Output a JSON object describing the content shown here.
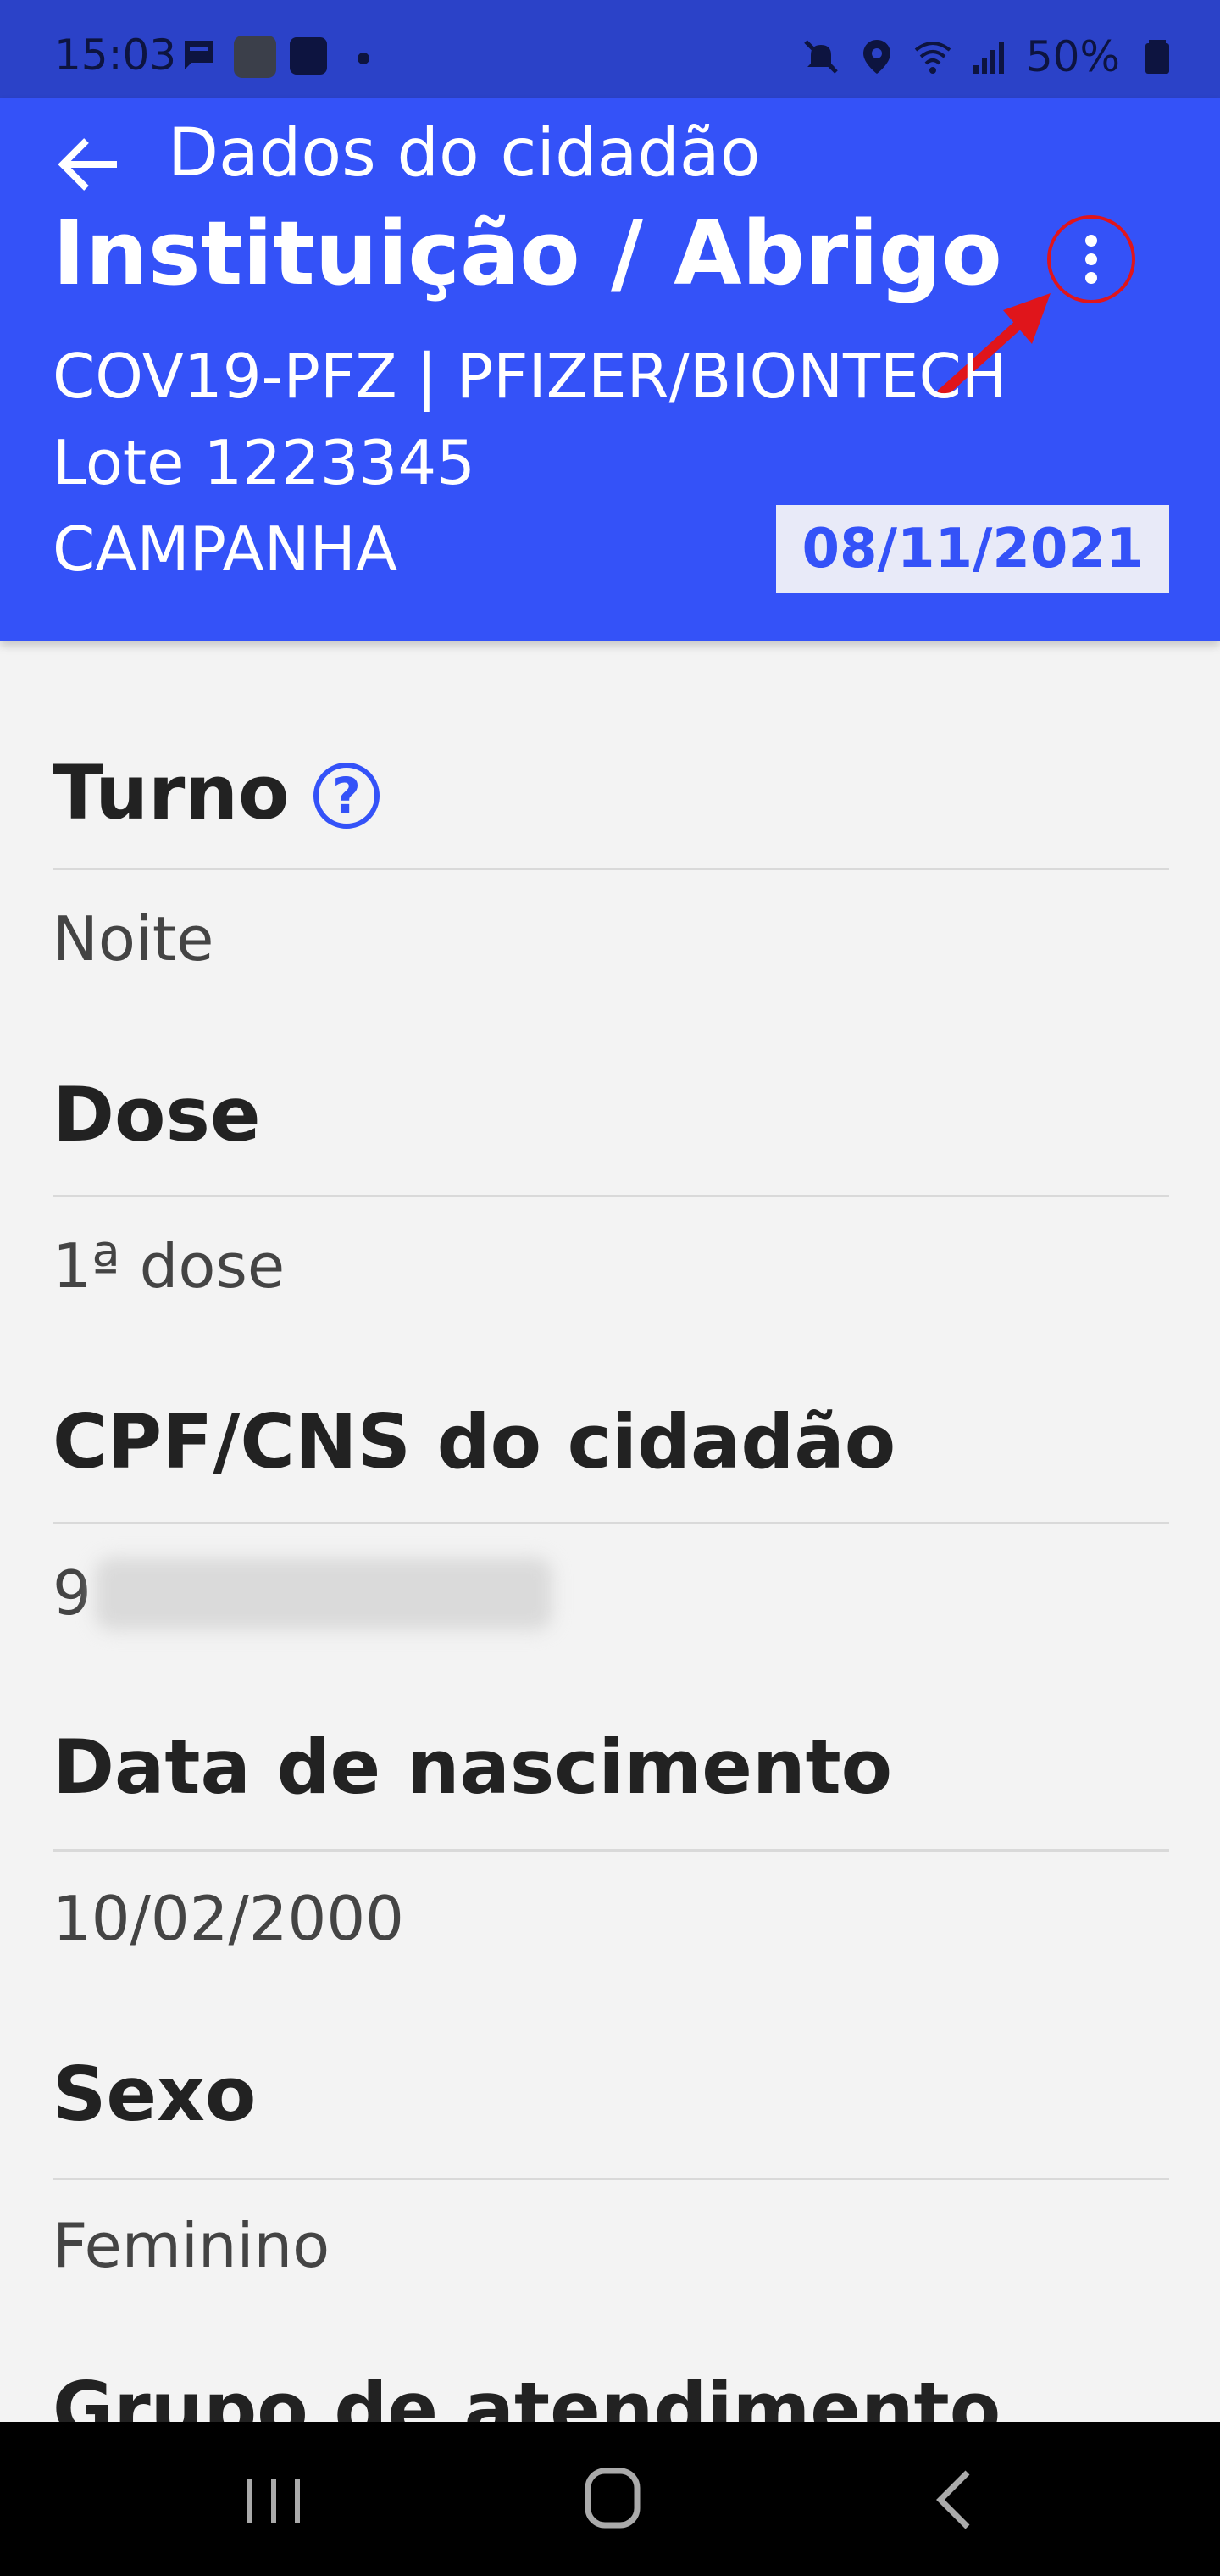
{
  "status_bar": {
    "time": "15:03",
    "battery": "50%",
    "icons": [
      "chat-icon",
      "app-icon",
      "pix-icon",
      "dot-icon",
      "mute-icon",
      "location-icon",
      "wifi-icon",
      "signal-icon",
      "battery-icon"
    ]
  },
  "header": {
    "title": "Dados do cidadão",
    "institution": "Instituição / Abrigo",
    "vaccine": "COV19-PFZ | PFIZER/BIONTECH",
    "lot": "Lote 1223345",
    "campaign": "CAMPANHA",
    "date": "08/11/2021",
    "accent_color": "#3452f8",
    "annotation_color": "#e0151b"
  },
  "fields": [
    {
      "label": "Turno",
      "value": "Noite",
      "help_icon": "question-circle-icon"
    },
    {
      "label": "Dose",
      "value": "1ª dose"
    },
    {
      "label": "CPF/CNS do cidadão",
      "value": "9"
    },
    {
      "label": "Data de nascimento",
      "value": "10/02/2000"
    },
    {
      "label": "Sexo",
      "value": "Feminino"
    },
    {
      "label": "Grupo de atendimento"
    }
  ],
  "nav_bar": {
    "buttons": [
      "recent-apps-icon",
      "home-icon",
      "back-icon"
    ]
  }
}
